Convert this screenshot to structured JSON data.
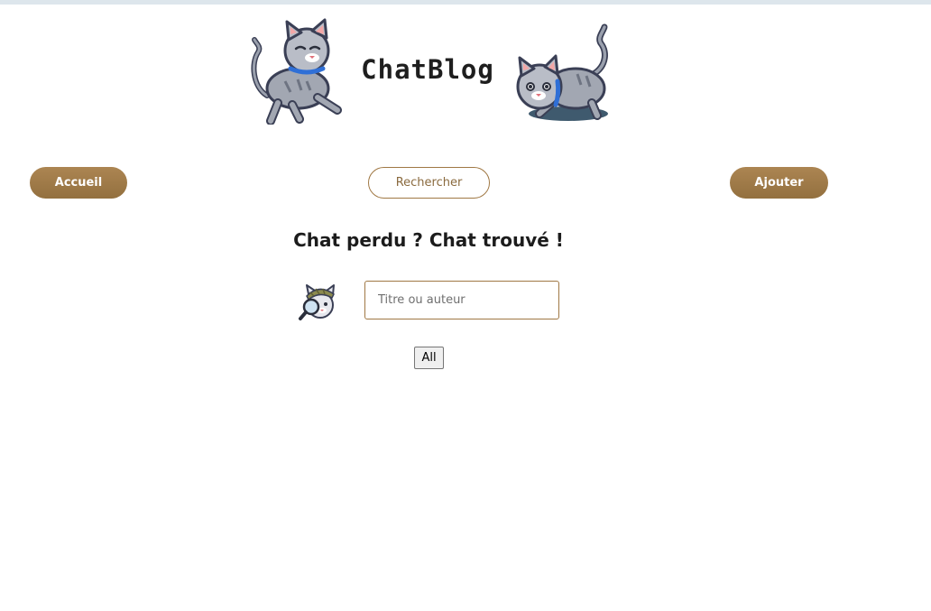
{
  "header": {
    "site_title": "ChatBlog",
    "left_image": "walking-cat-icon",
    "right_image": "crouching-cat-icon"
  },
  "nav": {
    "home_label": "Accueil",
    "search_label": "Rechercher",
    "add_label": "Ajouter"
  },
  "main": {
    "heading": "Chat perdu ? Chat trouvé !",
    "search_icon": "detective-cat-icon",
    "search_placeholder": "Titre ou auteur",
    "all_button_label": "All"
  },
  "colors": {
    "accent_brown": "#a07844",
    "title_text": "#1e1e1e"
  }
}
